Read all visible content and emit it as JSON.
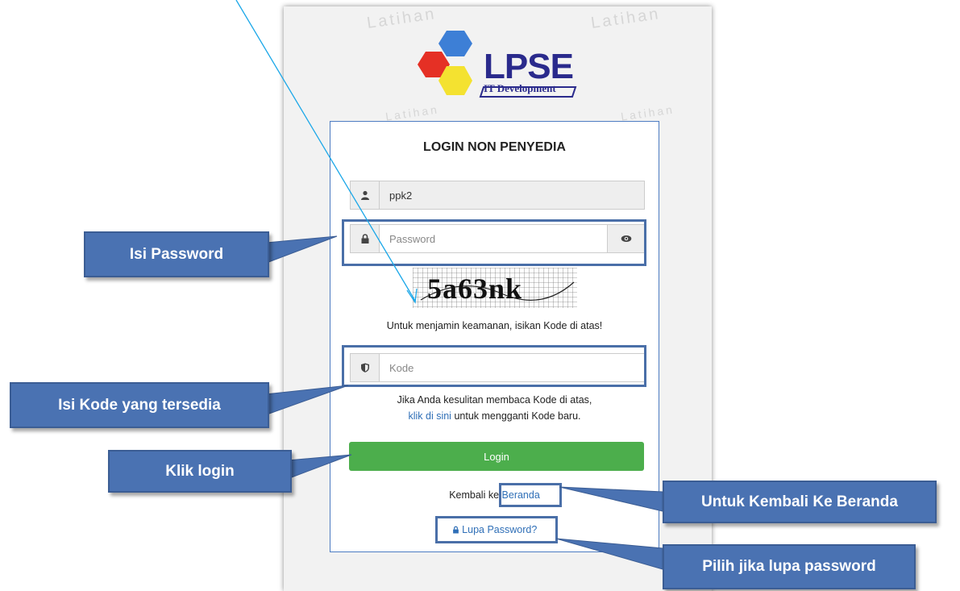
{
  "logo": {
    "title": "LPSE",
    "subtitle": "IT Development",
    "watermark": "Latihan"
  },
  "login": {
    "title": "LOGIN NON PENYEDIA",
    "username_value": "ppk2",
    "password_placeholder": "Password",
    "captcha_text": "5a63nk",
    "captcha_instruction": "Untuk menjamin keamanan, isikan Kode di atas!",
    "code_placeholder": "Kode",
    "help_line1": "Jika Anda kesulitan membaca Kode di atas,",
    "help_link": "klik di sini",
    "help_line2_rest": "untuk mengganti Kode baru.",
    "login_button": "Login",
    "back_prefix": "Kembali ke",
    "back_link": "Beranda",
    "forgot_link": "Lupa Password?"
  },
  "callouts": {
    "password": "Isi Password",
    "code": "Isi Kode yang tersedia",
    "login": "Klik login",
    "home": "Untuk Kembali Ke Beranda",
    "forgot": "Pilih jika lupa password"
  },
  "colors": {
    "callout_bg": "#4a72b2",
    "login_button": "#4cae4c",
    "link": "#2f6fb7",
    "logo_text": "#2a2a8c"
  }
}
